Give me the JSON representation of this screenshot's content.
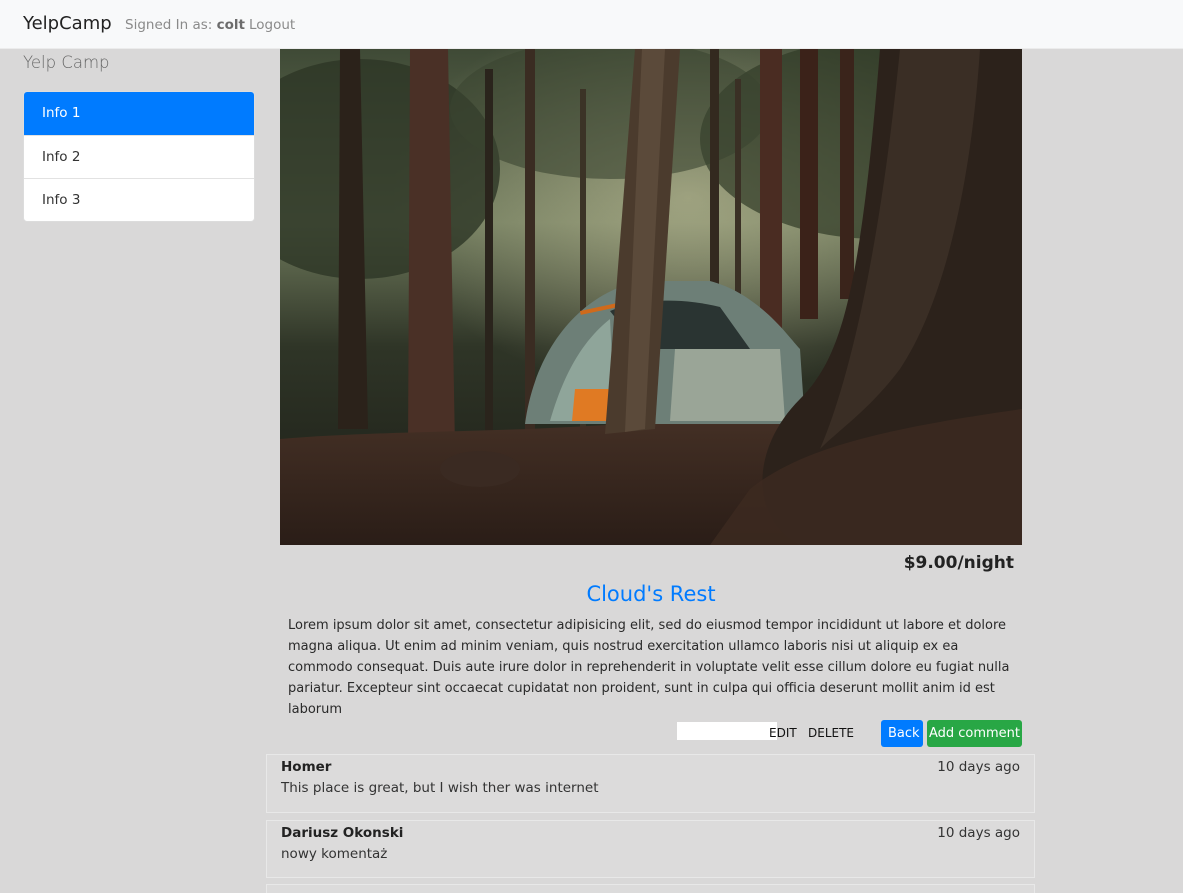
{
  "navbar": {
    "brand": "YelpCamp",
    "signed_in_prefix": "Signed In as:",
    "username": "colt",
    "logout": "Logout"
  },
  "sidebar": {
    "title": "Yelp Camp",
    "items": [
      {
        "label": "Info 1",
        "active": true
      },
      {
        "label": "Info 2",
        "active": false
      },
      {
        "label": "Info 3",
        "active": false
      }
    ]
  },
  "campground": {
    "price": "$9.00/night",
    "name": "Cloud's Rest",
    "description": "Lorem ipsum dolor sit amet, consectetur adipisicing elit, sed do eiusmod tempor incididunt ut labore et dolore magna aliqua. Ut enim ad minim veniam, quis nostrud exercitation ullamco laboris nisi ut aliquip ex ea commodo consequat. Duis aute irure dolor in reprehenderit in voluptate velit esse cillum dolore eu fugiat nulla pariatur. Excepteur sint occaecat cupidatat non proident, sunt in culpa qui officia deserunt mollit anim id est laborum"
  },
  "actions": {
    "edit": "EDIT",
    "delete": "DELETE",
    "back": "Back",
    "add_comment": "Add comment"
  },
  "comments": [
    {
      "author": "Homer",
      "time": "10 days ago",
      "text": "This place is great, but I wish ther was internet"
    },
    {
      "author": "Dariusz Okonski",
      "time": "10 days ago",
      "text": "nowy komentaż"
    }
  ],
  "colors": {
    "primary": "#007bff",
    "success": "#28a745",
    "page_background": "#d9d8d8"
  }
}
